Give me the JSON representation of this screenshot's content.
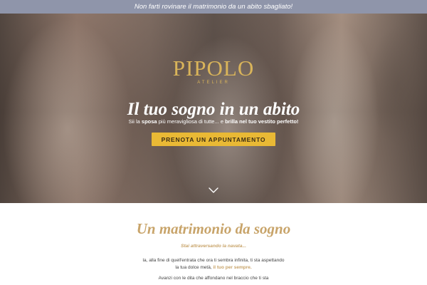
{
  "topbar": {
    "text": "Non farti rovinare il matrimonio da un abito sbagliato!"
  },
  "hero": {
    "logo": "PIPOLO",
    "logo_sub": "ATELIER",
    "headline": "Il tuo sogno in un abito",
    "sub_1": "Sii la ",
    "sub_2": "sposa",
    "sub_3": " più meravigliosa di tutte... e ",
    "sub_4": "brilla nel tuo vestito perfetto!",
    "cta_label": "PRENOTA UN APPUNTAMENTO",
    "scroll_icon": "chevron-down-icon"
  },
  "section": {
    "title": "Un matrimonio da sogno",
    "kicker": "Stai attraversando la navata...",
    "p1_a": "la, alla fine di quell'entrata che ora ti sembra infinita, ti sta aspettando la tua dolce metà, ",
    "p1_b": "il tuo per sempre.",
    "p2": "Avanzi con le dita che affondano nel braccio che ti sta"
  },
  "colors": {
    "topbar_bg": "#8f95aa",
    "gold": "#d9b45a",
    "cta_bg": "#e9b935",
    "title_gold": "#c8a46a"
  }
}
